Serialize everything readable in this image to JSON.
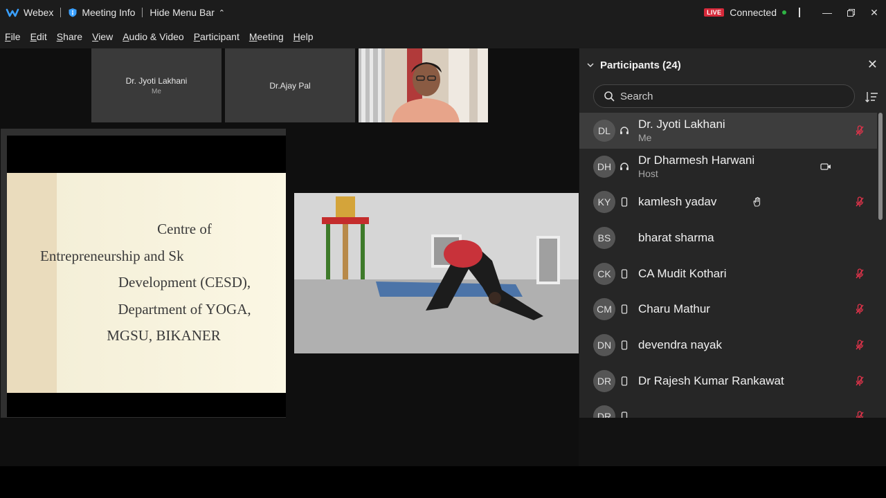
{
  "titlebar": {
    "app_name": "Webex",
    "meeting_info": "Meeting Info",
    "hide_menu_bar": "Hide Menu Bar",
    "live_badge": "LIVE",
    "status": "Connected",
    "icons": [
      "webex-logo-icon",
      "info-icon",
      "chevron-up-icon",
      "minimize-icon",
      "restore-icon",
      "close-icon"
    ]
  },
  "menu": [
    "File",
    "Edit",
    "Share",
    "View",
    "Audio & Video",
    "Participant",
    "Meeting",
    "Help"
  ],
  "stage": {
    "thumbnails": [
      {
        "name": "Dr. Jyoti Lakhani",
        "sub": "Me"
      },
      {
        "name": "Dr.Ajay Pal",
        "sub": ""
      }
    ],
    "slide_lines": [
      "Centre of",
      "Entrepreneurship and Sk",
      "Development (CESD),",
      "Department of YOGA,",
      "MGSU, BIKANER"
    ]
  },
  "participants": {
    "title": "Participants (24)",
    "search_placeholder": "Search",
    "items": [
      {
        "initials": "DL",
        "name": "Dr. Jyoti Lakhani",
        "role": "Me",
        "device": "headset",
        "muted": true
      },
      {
        "initials": "DH",
        "name": "Dr Dharmesh Harwani",
        "role": "Host",
        "device": "headset",
        "camera": true,
        "muted": false
      },
      {
        "initials": "KY",
        "name": "kamlesh yadav",
        "role": "",
        "device": "phone",
        "hand": true,
        "muted": true
      },
      {
        "initials": "BS",
        "name": "bharat sharma",
        "role": "",
        "device": "none",
        "muted": false
      },
      {
        "initials": "CK",
        "name": "CA Mudit Kothari",
        "role": "",
        "device": "phone",
        "muted": true
      },
      {
        "initials": "CM",
        "name": "Charu Mathur",
        "role": "",
        "device": "phone",
        "muted": true
      },
      {
        "initials": "DN",
        "name": "devendra nayak",
        "role": "",
        "device": "phone",
        "muted": true
      },
      {
        "initials": "DR",
        "name": "Dr Rajesh Kumar Rankawat",
        "role": "",
        "device": "phone",
        "muted": true
      },
      {
        "initials": "DR",
        "name": "",
        "role": "",
        "device": "phone",
        "muted": true
      }
    ]
  },
  "colors": {
    "live": "#d6293a",
    "connected_dot": "#2fb344",
    "mute": "#e0334a",
    "panel": "#262626",
    "selected_row": "#3d3d3d"
  }
}
